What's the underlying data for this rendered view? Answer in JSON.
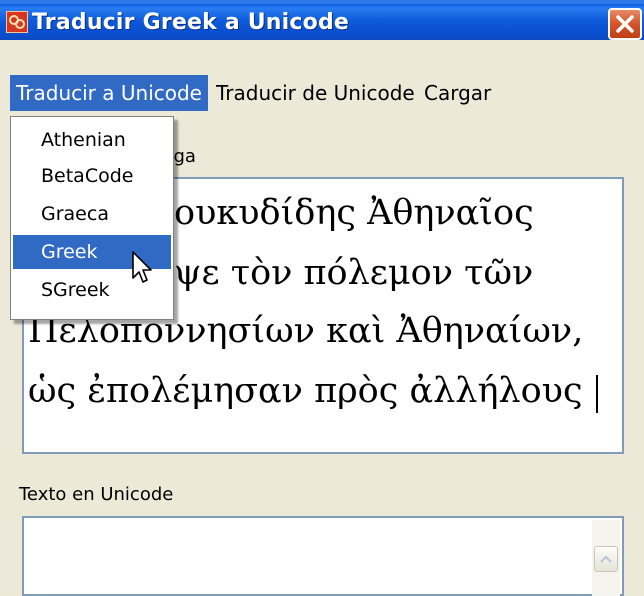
{
  "window": {
    "title": "Traducir Greek a Unicode",
    "app_icon": "app-logo-icon",
    "close_icon": "close-icon"
  },
  "menubar": {
    "items": [
      {
        "label": "Traducir a Unicode",
        "active": true
      },
      {
        "label": "Traducir de Unicode",
        "active": false
      },
      {
        "label": "Cargar",
        "active": false
      }
    ]
  },
  "dropdown": {
    "items": [
      "Athenian",
      "BetaCode",
      "Graeca",
      "Greek",
      "SGreek"
    ],
    "selected": "Greek"
  },
  "greek_section": {
    "label_visible": "riega",
    "lines": [
      "ουκυδίδης Ἀθηναῖος",
      "ψε τὸν πόλεμον τῶν",
      "Πελοποννησίων καὶ Ἀθηναίων,",
      "ὡς ἐπολέμησαν πρὸς ἀλλήλους"
    ]
  },
  "unicode_section": {
    "label": "Texto en Unicode",
    "value": ""
  },
  "colors": {
    "titlebar": "#0a5fe3",
    "selection": "#316ac5",
    "close_button": "#d4542a",
    "window_bg": "#ece9d8"
  }
}
